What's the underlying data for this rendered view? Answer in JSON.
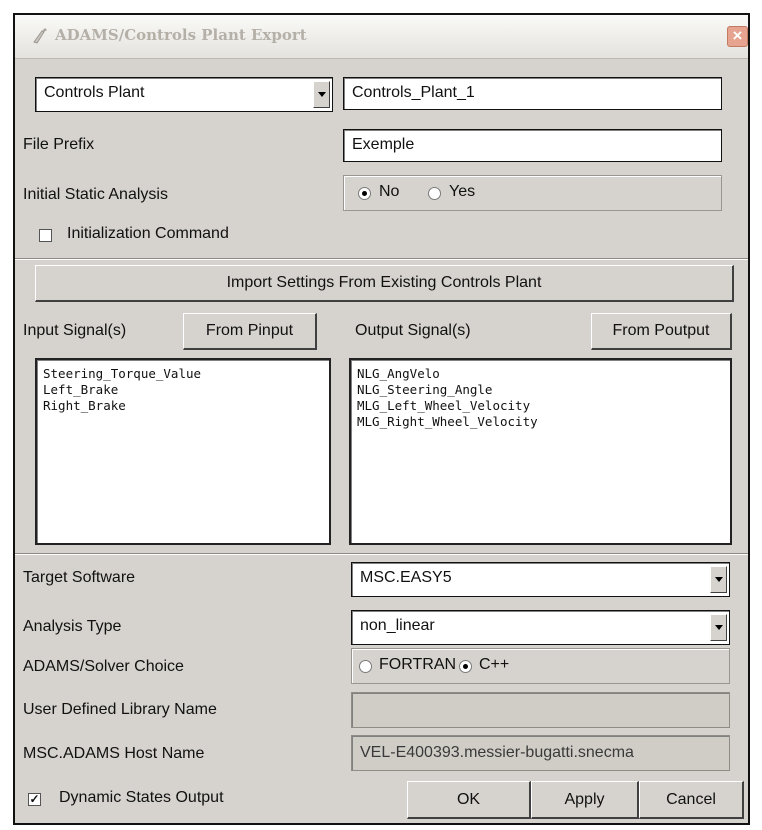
{
  "window": {
    "title": "ADAMS/Controls Plant Export",
    "close_glyph": "×"
  },
  "plant": {
    "type_selected": "Controls Plant",
    "name_value": "Controls_Plant_1"
  },
  "file_prefix": {
    "label": "File Prefix",
    "value": "Exemple"
  },
  "initial_static": {
    "label": "Initial Static Analysis",
    "options": [
      "No",
      "Yes"
    ],
    "selected": "No"
  },
  "init_command": {
    "label": "Initialization Command",
    "checked": false
  },
  "import_button": "Import Settings From Existing Controls Plant",
  "inputs": {
    "label": "Input Signal(s)",
    "button": "From Pinput",
    "items": [
      "Steering_Torque_Value",
      "Left_Brake",
      "Right_Brake"
    ]
  },
  "outputs": {
    "label": "Output Signal(s)",
    "button": "From Poutput",
    "items": [
      "NLG_AngVelo",
      "NLG_Steering_Angle",
      "MLG_Left_Wheel_Velocity",
      "MLG_Right_Wheel_Velocity"
    ]
  },
  "target_software": {
    "label": "Target Software",
    "value": "MSC.EASY5"
  },
  "analysis_type": {
    "label": "Analysis Type",
    "value": "non_linear"
  },
  "solver_choice": {
    "label": "ADAMS/Solver Choice",
    "options": [
      "FORTRAN",
      "C++"
    ],
    "selected": "C++"
  },
  "user_library": {
    "label": "User Defined Library Name",
    "value": ""
  },
  "host_name": {
    "label": "MSC.ADAMS Host Name",
    "value": "VEL-E400393.messier-bugatti.snecma"
  },
  "dynamic_states": {
    "label": "Dynamic States Output",
    "checked": true,
    "check_glyph": "✓"
  },
  "buttons": {
    "ok": "OK",
    "apply": "Apply",
    "cancel": "Cancel"
  },
  "icons": [
    "app-icon",
    "close-icon",
    "dropdown-arrow-icon",
    "radio-icon",
    "checkbox-icon"
  ]
}
